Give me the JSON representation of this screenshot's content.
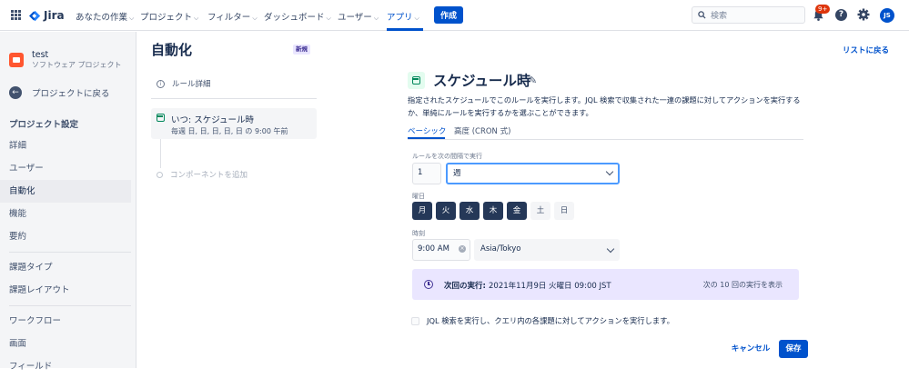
{
  "topnav": {
    "logo_text": "Jira",
    "items": [
      "あなたの作業",
      "プロジェクト",
      "フィルター",
      "ダッシュボード",
      "ユーザー",
      "アプリ"
    ],
    "active_item": "アプリ",
    "create_label": "作成",
    "search_placeholder": "検索",
    "notification_count": "9+",
    "help_glyph": "?",
    "avatar_initials": "JS",
    "accent_color": "#0052cc"
  },
  "sidebar": {
    "project_name": "test",
    "project_type": "ソフトウェア プロジェクト",
    "back_label": "プロジェクトに戻る",
    "section_heading": "プロジェクト設定",
    "items": [
      "詳細",
      "ユーザー",
      "自動化",
      "機能",
      "要約",
      "課題タイプ",
      "課題レイアウト",
      "ワークフロー",
      "画面",
      "フィールド"
    ],
    "selected_item": "自動化"
  },
  "rule": {
    "page_title": "自動化",
    "new_badge": "新規",
    "details_label": "ルール詳細",
    "trigger_title": "いつ: スケジュール時",
    "trigger_subtitle": "毎週 日, 日, 日, 日, 日 の 9:00 午前",
    "add_component_label": "コンポーネントを追加",
    "back_to_list": "リストに戻る"
  },
  "schedule": {
    "title": "スケジュール時",
    "description": "指定されたスケジュールでこのルールを実行します。JQL 検索で収集された一連の課題に対してアクションを実行するか、単純にルールを実行するかを選ぶことができます。",
    "tabs": [
      "ベーシック",
      "高度 (CRON 式)"
    ],
    "active_tab": "ベーシック",
    "interval_label": "ルールを次の間隔で実行",
    "interval_value": "1",
    "interval_unit": "週",
    "weekday_label": "曜日",
    "days": [
      {
        "label": "月",
        "selected": true
      },
      {
        "label": "火",
        "selected": true
      },
      {
        "label": "水",
        "selected": true
      },
      {
        "label": "木",
        "selected": true
      },
      {
        "label": "金",
        "selected": true
      },
      {
        "label": "土",
        "selected": false
      },
      {
        "label": "日",
        "selected": false
      }
    ],
    "time_label": "時刻",
    "time_value": "9:00 AM",
    "timezone_value": "Asia/Tokyo",
    "next_run_label": "次回の実行:",
    "next_run_value": "2021年11月9日 火曜日 09:00 JST",
    "next_runs_link": "次の 10 回の実行を表示",
    "jql_checkbox_label": "JQL 検索を実行し、クエリ内の各課題に対してアクションを実行します。",
    "jql_checked": false,
    "cancel_label": "キャンセル",
    "save_label": "保存"
  }
}
